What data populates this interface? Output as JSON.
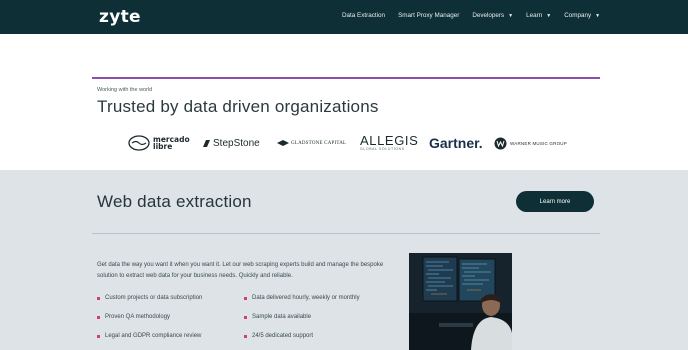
{
  "header": {
    "logo": "zyte",
    "nav": [
      {
        "label": "Data Extraction",
        "dropdown": false
      },
      {
        "label": "Smart Proxy Manager",
        "dropdown": false
      },
      {
        "label": "Developers",
        "dropdown": true
      },
      {
        "label": "Learn",
        "dropdown": true
      },
      {
        "label": "Company",
        "dropdown": true
      }
    ]
  },
  "trusted": {
    "eyebrow": "Working with the world",
    "title": "Trusted by data driven organizations",
    "logos": {
      "mercado_line1": "mercado",
      "mercado_line2": "libre",
      "stepstone": "StepStone",
      "gladstone": "GLADSTONE CAPITAL",
      "allegis": "ALLEGIS",
      "allegis_sub": "GLOBAL SOLUTIONS",
      "gartner": "Gartner.",
      "warner": "WARNER MUSIC GROUP"
    }
  },
  "extraction": {
    "title": "Web data extraction",
    "button": "Learn more",
    "description": "Get data the way you want it when you want it. Let our web scraping experts build and manage the bespoke solution to extract web data for your business needs. Quickly and reliable.",
    "bullets_left": [
      "Custom projects or data subscription",
      "Proven QA methodology",
      "Legal and GDPR compliance review"
    ],
    "bullets_right": [
      "Data delivered hourly, weekly or monthly",
      "Sample data available",
      "24/5 dedicated support"
    ]
  },
  "colors": {
    "header_bg": "#0d2f35",
    "accent_purple": "#8a4fb0",
    "bullet_pink": "#d13f64",
    "section_bg": "#dde3e6"
  }
}
